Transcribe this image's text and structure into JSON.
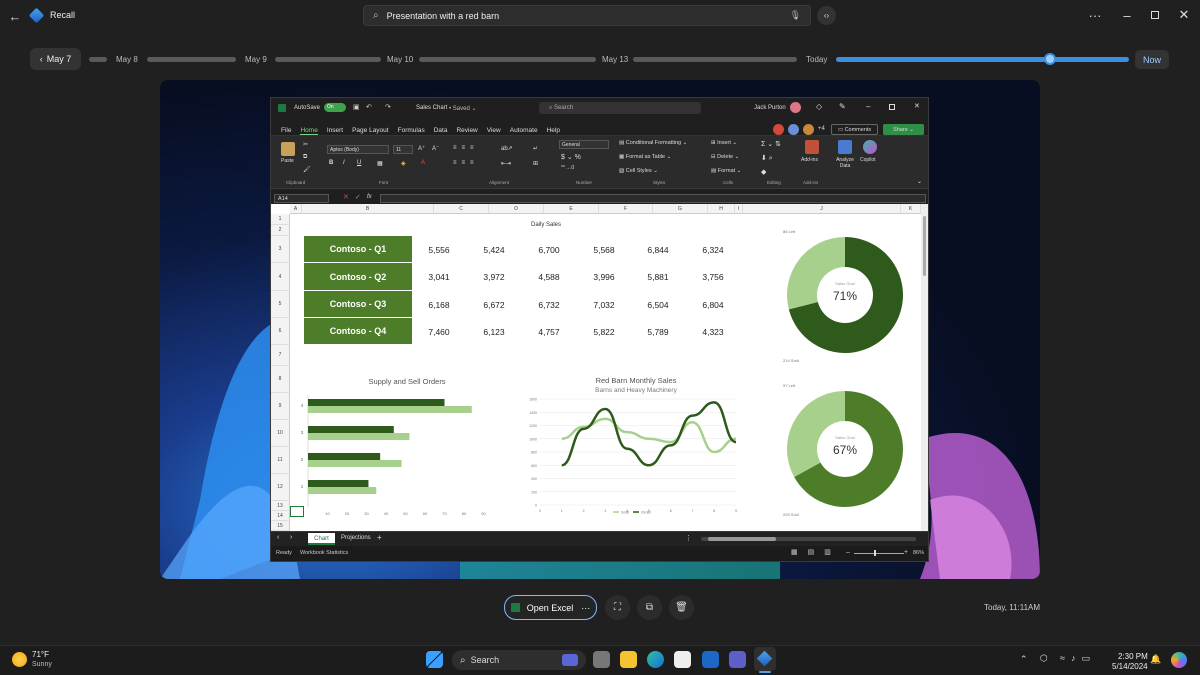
{
  "titlebar": {
    "app_title": "Recall",
    "search_value": "Presentation with a red barn"
  },
  "timeline": {
    "current_date": "May 7",
    "labels": [
      "May 8",
      "May 9",
      "May 10",
      "May 13",
      "Today"
    ],
    "now_label": "Now",
    "slider_position": 0.73
  },
  "excel": {
    "autosave": "AutoSave",
    "toggle": "On",
    "filename": "Sales Chart",
    "saved": "Saved",
    "search_placeholder": "Search",
    "user": "Jack Purton",
    "extra_collab": "+4",
    "comments": "Comments",
    "share": "Share",
    "menu": [
      "File",
      "Home",
      "Insert",
      "Page Layout",
      "Formulas",
      "Data",
      "Review",
      "View",
      "Automate",
      "Help"
    ],
    "ribbon": {
      "paste": "Paste",
      "font_name": "Aptos (Body)",
      "font_size": "11",
      "number_format": "General",
      "cond_format": "Conditional Formatting",
      "format_table": "Format as Table",
      "cell_styles": "Cell Styles",
      "insert": "Insert",
      "delete": "Delete",
      "format": "Format",
      "addins": "Add-ins",
      "analyze": "Analyze Data",
      "copilot": "Copilot",
      "groups": [
        "Clipboard",
        "Font",
        "Alignment",
        "Number",
        "Styles",
        "Cells",
        "Editing",
        "Add-ins"
      ]
    },
    "name_box": "A14",
    "fx": "fx",
    "columns": [
      "A",
      "B",
      "C",
      "D",
      "E",
      "F",
      "G",
      "H",
      "I",
      "J",
      "K"
    ],
    "rows": [
      "1",
      "2",
      "3",
      "4",
      "5",
      "6",
      "7",
      "8",
      "9",
      "10",
      "11",
      "12",
      "13",
      "14",
      "15"
    ],
    "table_title": "Daily Sales",
    "table": [
      {
        "label": "Contoso - Q1",
        "values": [
          "5,556",
          "5,424",
          "6,700",
          "5,568",
          "6,844",
          "6,324"
        ]
      },
      {
        "label": "Contoso - Q2",
        "values": [
          "3,041",
          "3,972",
          "4,588",
          "3,996",
          "5,881",
          "3,756"
        ]
      },
      {
        "label": "Contoso - Q3",
        "values": [
          "6,168",
          "6,672",
          "6,732",
          "7,032",
          "6,504",
          "6,804"
        ]
      },
      {
        "label": "Contoso - Q4",
        "values": [
          "7,460",
          "6,123",
          "4,757",
          "5,822",
          "5,789",
          "4,323"
        ]
      }
    ],
    "sheet_tabs": [
      "Chart",
      "Projections"
    ],
    "status_ready": "Ready",
    "status_stats": "Workbook Statistics",
    "zoom": "86%"
  },
  "chart_data": [
    {
      "type": "bar",
      "title": "Supply and Sell Orders",
      "categories": [
        "4",
        "3",
        "2",
        "1"
      ],
      "series": [
        {
          "name": "Sold",
          "values": [
            70,
            44,
            37,
            31
          ]
        },
        {
          "name": "Supply",
          "values": [
            84,
            52,
            48,
            35
          ]
        }
      ],
      "xticks": [
        "10",
        "20",
        "30",
        "40",
        "50",
        "60",
        "70",
        "80",
        "90"
      ],
      "xlim": [
        0,
        100
      ]
    },
    {
      "type": "line",
      "title": "Red Barn Monthly Sales",
      "subtitle": "Barns and Heavy Machinery",
      "x": [
        1,
        2,
        3,
        4,
        5,
        6,
        7,
        8,
        9
      ],
      "yticks": [
        "0",
        "200",
        "400",
        "600",
        "800",
        "1000",
        "1200",
        "1400",
        "1600"
      ],
      "xticks": [
        "0",
        "1",
        "2",
        "3",
        "4",
        "5",
        "6",
        "7",
        "8",
        "9"
      ],
      "ylim": [
        0,
        1600
      ],
      "series": [
        {
          "name": "Sold",
          "values": [
            1000,
            1180,
            1300,
            1100,
            1000,
            950,
            1250,
            800,
            1000
          ]
        },
        {
          "name": "Order",
          "values": [
            600,
            1150,
            1450,
            850,
            600,
            900,
            1350,
            1550,
            950
          ]
        }
      ]
    },
    {
      "type": "pie",
      "label": "Sales Goal",
      "percent_label": "71%",
      "value": 71,
      "left": "86 Left",
      "sold": "214 Sold"
    },
    {
      "type": "pie",
      "label": "Sales Goal",
      "percent_label": "67%",
      "value": 67,
      "left": "97 Left",
      "sold": "203 Sold"
    }
  ],
  "actions": {
    "open_label": "Open Excel",
    "timestamp": "Today, 11:11AM"
  },
  "taskbar": {
    "temp": "71°F",
    "weather": "Sunny",
    "search": "Search",
    "time": "2:30 PM",
    "date": "5/14/2024"
  },
  "colors": {
    "accent": "#4aa3f0",
    "dark_green": "#2e5a1c",
    "mid_green": "#4e7d2a",
    "light_green": "#a8d08d"
  }
}
